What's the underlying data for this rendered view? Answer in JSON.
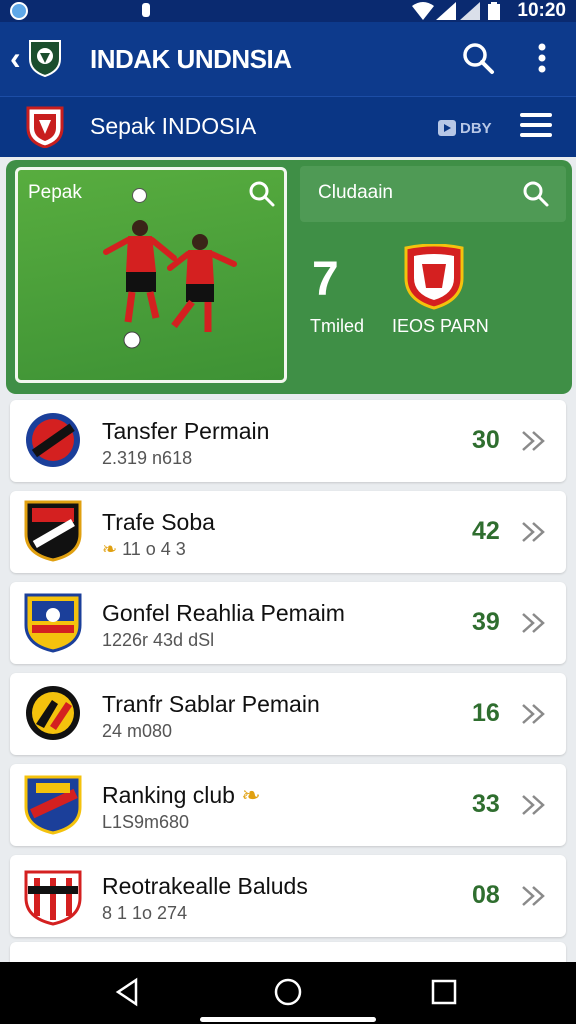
{
  "status_bar": {
    "time": "10:20"
  },
  "app_bar": {
    "title": "INDAK UNDNSIA"
  },
  "sub_bar": {
    "title": "Sepak INDOSIA",
    "tv_label": "DBY"
  },
  "hero": {
    "match_label": "Pepak",
    "club_search_label": "Cludaain",
    "number": "7",
    "number_label": "Tmiled",
    "club_name": "IEOS PARN"
  },
  "rows": [
    {
      "name": "Tansfer Permain",
      "sub": "2.319 n618",
      "count": "30"
    },
    {
      "name": "Trafe Soba",
      "sub": "11 o 4 3",
      "count": "42"
    },
    {
      "name": "Gonfel Reahlia Pemaim",
      "sub": "1226r 43d dSl",
      "count": "39"
    },
    {
      "name": "Tranfr Sablar Pemain",
      "sub": "24 m080",
      "count": "16"
    },
    {
      "name": "Ranking club",
      "sub": "L1S9m680",
      "count": "33"
    },
    {
      "name": "Reotrakealle Baluds",
      "sub": "8 1 1o 274",
      "count": "08"
    }
  ],
  "colors": {
    "primary": "#0d3a8c",
    "secondary": "#0a3685",
    "hero_green": "#3f8f46",
    "count_green": "#2f6e2f"
  }
}
